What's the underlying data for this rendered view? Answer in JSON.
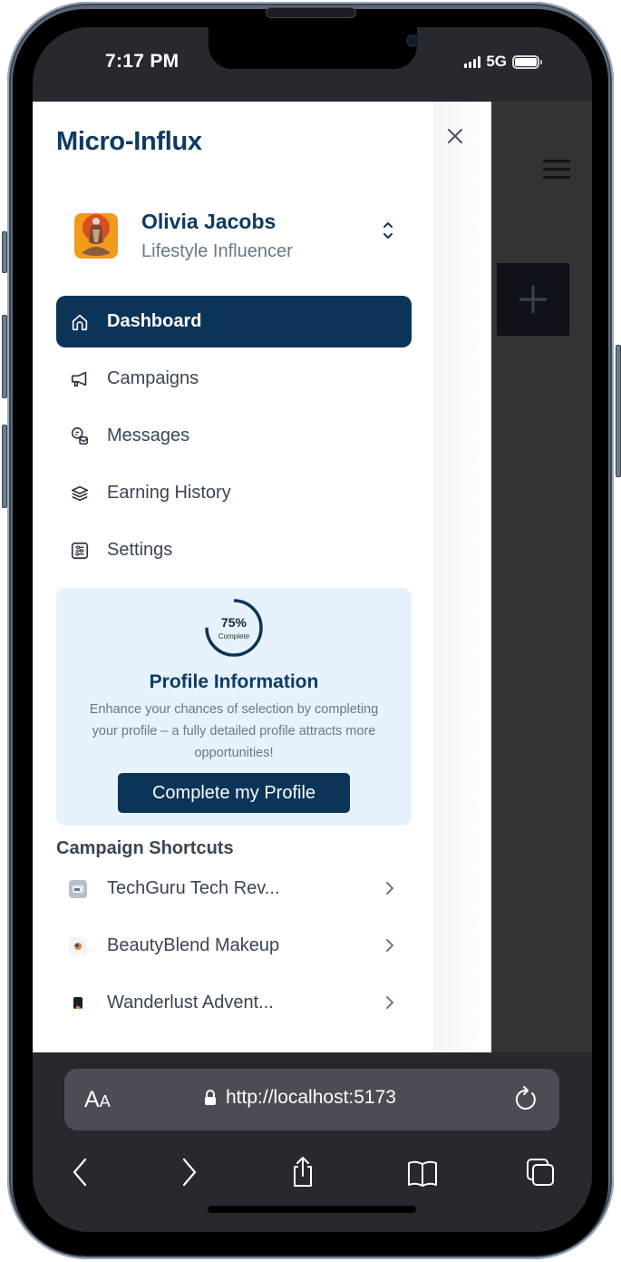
{
  "status_bar": {
    "time": "7:17 PM",
    "network": "5G",
    "battery_level": 1.0
  },
  "app": {
    "brand": "Micro-Influx",
    "close_icon": "close-icon",
    "user": {
      "name": "Olivia Jacobs",
      "role": "Lifestyle Influencer",
      "switcher_icon": "chevron-up-down-icon"
    },
    "nav": [
      {
        "label": "Dashboard",
        "icon": "home-icon",
        "active": true
      },
      {
        "label": "Campaigns",
        "icon": "megaphone-icon",
        "active": false
      },
      {
        "label": "Messages",
        "icon": "chat-bubbles-icon",
        "active": false
      },
      {
        "label": "Earning History",
        "icon": "layers-icon",
        "active": false
      },
      {
        "label": "Settings",
        "icon": "sliders-icon",
        "active": false
      }
    ],
    "profile_card": {
      "progress_percent": 75,
      "progress_label": "75%",
      "progress_sublabel": "Complete",
      "title": "Profile Information",
      "description": "Enhance your chances of selection by completing your profile – a fully detailed profile attracts more opportunities!",
      "button_label": "Complete my Profile"
    },
    "shortcuts": {
      "title": "Campaign Shortcuts",
      "items": [
        {
          "label": "TechGuru Tech Rev..."
        },
        {
          "label": "BeautyBlend Makeup"
        },
        {
          "label": "Wanderlust Advent..."
        }
      ]
    },
    "background": {
      "menu_icon": "hamburger-icon",
      "add_icon": "plus-icon"
    }
  },
  "browser": {
    "text_size_label": "AA",
    "url": "http://localhost:5173",
    "toolbar": [
      "back",
      "forward",
      "share",
      "bookmarks",
      "tabs"
    ]
  },
  "colors": {
    "primary": "#0b3459",
    "brand_text": "#0d3a63",
    "card_bg": "#e6f3fc",
    "body_text": "#3a4556",
    "muted_text": "#6b7787"
  }
}
